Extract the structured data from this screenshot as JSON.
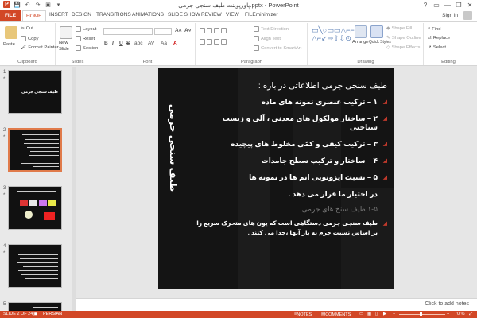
{
  "window": {
    "title": "پاورپوینت طیف سنجی جرمی.pptx - PowerPoint",
    "controls": [
      "?",
      "▭",
      "—",
      "❐",
      "✕"
    ]
  },
  "qat": [
    "P",
    "💾",
    "↶",
    "↷",
    "▣",
    "▾"
  ],
  "tabs": [
    "FILE",
    "HOME",
    "INSERT",
    "DESIGN",
    "TRANSITIONS",
    "ANIMATIONS",
    "SLIDE SHOW",
    "REVIEW",
    "VIEW",
    "FILEminimizer"
  ],
  "account": {
    "sign_in": "Sign in"
  },
  "ribbon": {
    "clipboard": {
      "label": "Clipboard",
      "paste": "Paste",
      "cut": "Cut",
      "copy": "Copy",
      "format_painter": "Format Painter"
    },
    "slides": {
      "label": "Slides",
      "new_slide": "New",
      "new_slide2": "Slide",
      "layout": "Layout",
      "reset": "Reset",
      "section": "Section"
    },
    "font": {
      "label": "Font",
      "bold": "B",
      "italic": "I",
      "underline": "U",
      "strike": "S",
      "shadow": "abc",
      "spacing": "AV",
      "case": "Aa",
      "color": "A"
    },
    "paragraph": {
      "label": "Paragraph",
      "text_direction": "Text Direction",
      "align_text": "Align Text",
      "smartart": "Convert to SmartArt"
    },
    "drawing": {
      "label": "Drawing",
      "arrange": "Arrange",
      "quick_styles": "Quick Styles",
      "shape_fill": "Shape Fill",
      "shape_outline": "Shape Outline",
      "shape_effects": "Shape Effects"
    },
    "editing": {
      "label": "Editing",
      "find": "Find",
      "replace": "Replace",
      "select": "Select"
    }
  },
  "thumbnails": [
    {
      "num": "1",
      "title": "طیف سنجی جرمی"
    },
    {
      "num": "2"
    },
    {
      "num": "3"
    },
    {
      "num": "4"
    },
    {
      "num": "5"
    }
  ],
  "slide": {
    "vertical_title": "طیف سنجی جرمی",
    "heading": "طیف سنجی جرمی اطلاعاتی در باره :",
    "items": [
      "۱ – ترکیب عنصری نمونه های ماده",
      "۲ – ساختار مولکول های معدنی ، آلی و زیست شناختی",
      "۳ – ترکیب کیفی و کمّی مخلوط های پیچیده",
      "۴ – ساختار و ترکیب سطح جامدات",
      "۵ – نسبت ایزوتوپی اتم ها در نمونه ها"
    ],
    "closing": "در اختیار ما قرار می دهد .",
    "ghost": "۱-۵ طیف سنج های جرمی",
    "definition": "طیف سنجی جرمی دستگاهی است که یون های متحرک سریع را بر اساس نسبت جرم به بار آنها ،جدا می کنند ."
  },
  "notes": {
    "placeholder": "Click to add notes"
  },
  "status": {
    "slide": "SLIDE 2 OF 24",
    "language": "PERSIAN",
    "notes": "NOTES",
    "comments": "COMMENTS",
    "zoom": "70 %"
  }
}
